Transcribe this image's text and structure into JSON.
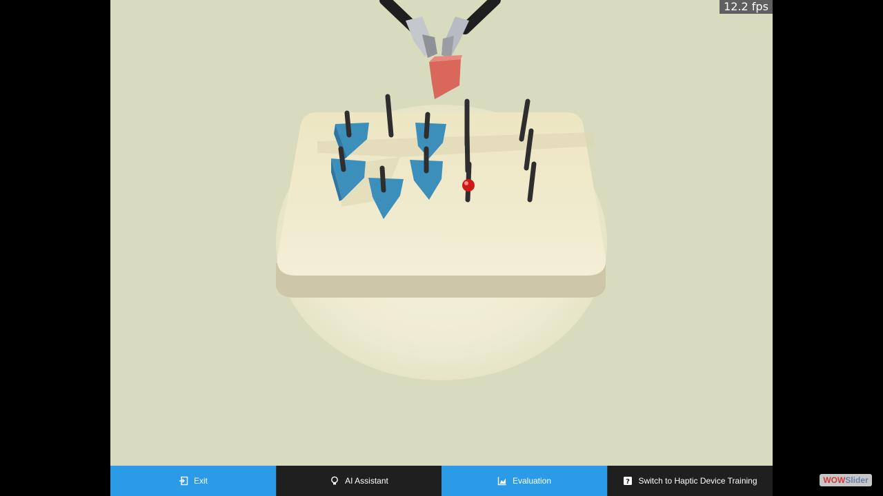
{
  "overlay": {
    "fps": "12.2 fps"
  },
  "toolbar": {
    "buttons": [
      {
        "label": "Exit",
        "icon": "exit-icon"
      },
      {
        "label": "AI Assistant",
        "icon": "lightbulb-icon"
      },
      {
        "label": "Evaluation",
        "icon": "chart-icon"
      },
      {
        "label": "Switch to Haptic Device Training",
        "icon": "help-icon"
      }
    ]
  },
  "watermark": {
    "part1": "WOW",
    "part2": "Slider"
  },
  "colors": {
    "background": "#d8dbbd",
    "board_top": "#ece7c6",
    "board_side": "#cfc8aa",
    "triangle_blue": "#3e93bf",
    "peg": "#2e2e2e",
    "held_block": "#d9675c",
    "ball": "#d01818",
    "button_blue": "#2b9be8",
    "button_dark": "#1f1f1f"
  }
}
